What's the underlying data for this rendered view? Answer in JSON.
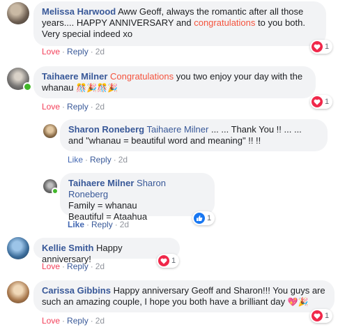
{
  "comments": [
    {
      "name": "Melissa Harwood",
      "text_before": "Aww Geoff, always the romantic after all those years.... HAPPY ANNIVERSARY and ",
      "highlight": "congratulations",
      "text_after": " to you both. Very special indeed xo",
      "actions": [
        "Love",
        "Reply",
        "2d"
      ],
      "reaction": {
        "type": "heart-icon",
        "count": "1"
      }
    },
    {
      "name": "Taihaere Milner",
      "highlight": "Congratulations",
      "text_after": " you two enjoy your day with the whanau ",
      "emoji": "🎊🎉🎊🎉",
      "actions": [
        "Love",
        "Reply",
        "2d"
      ],
      "reaction": {
        "type": "heart-icon",
        "count": "1"
      }
    },
    {
      "name": "Sharon Roneberg",
      "mention": "Taihaere Milner",
      "text_after": " ... ... Thank You !! ... ... and \"whanau = beautiful word and meaning\" !! !!",
      "actions": [
        "Like",
        "Reply",
        "2d"
      ]
    },
    {
      "name": "Taihaere Milner",
      "mention": "Sharon Roneberg",
      "line1": "Family = whanau",
      "line2": "Beautiful = Ataahua",
      "actions": [
        "Like",
        "Reply",
        "2d"
      ],
      "reaction": {
        "type": "thumbs-up-icon",
        "count": "1"
      }
    },
    {
      "name": "Kellie Smith",
      "text_after": " Happy anniversary!",
      "actions": [
        "Love",
        "Reply",
        "2d"
      ],
      "reaction": {
        "type": "heart-icon",
        "count": "1"
      }
    },
    {
      "name": "Carissa Gibbins",
      "text_after": " Happy anniversary Geoff and Sharon!!! You guys are such an amazing couple, I hope you both have a brilliant day ",
      "emoji": "💖🎉",
      "actions": [
        "Love",
        "Reply",
        "2d"
      ],
      "reaction": {
        "type": "heart-icon",
        "count": "1"
      }
    }
  ],
  "colors": {
    "name": "#385898",
    "love": "#f33e58",
    "like": "#4267b2",
    "highlight": "#f5533d",
    "bubble": "#f2f3f5",
    "online": "#42b72a"
  }
}
